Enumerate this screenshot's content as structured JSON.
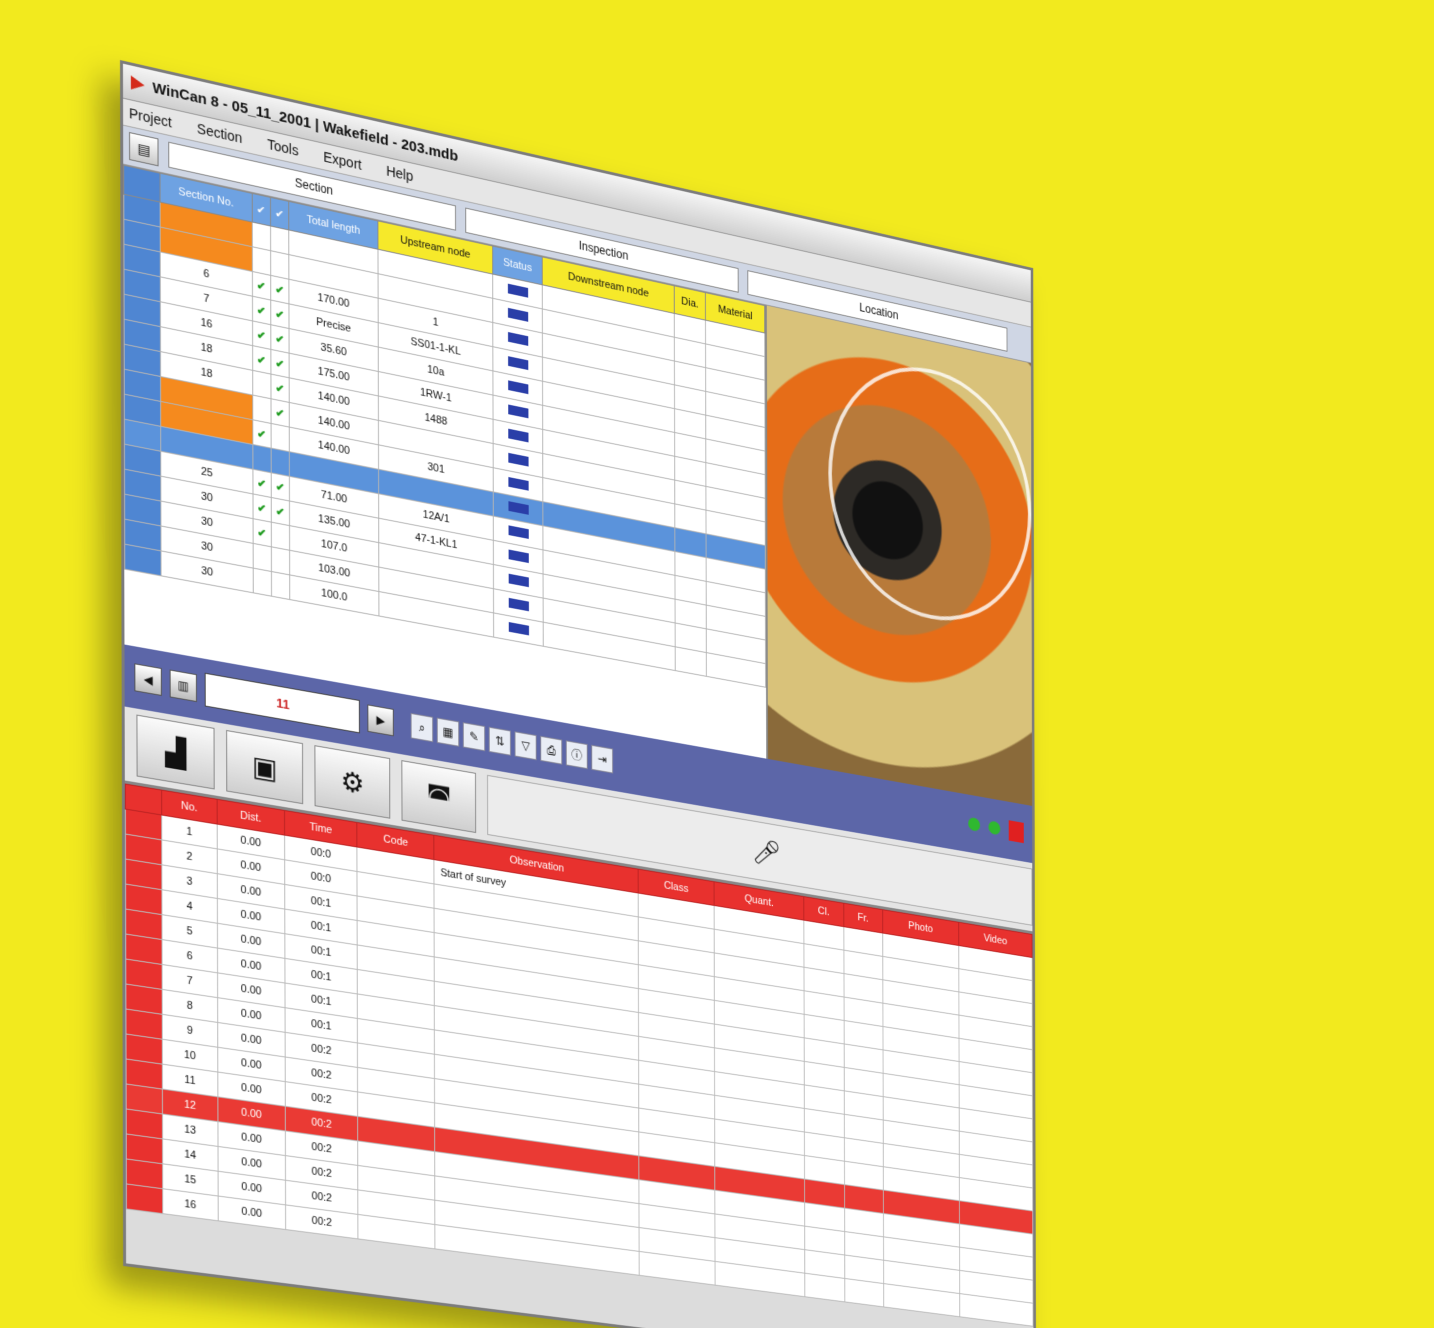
{
  "window": {
    "title": "WinCan 8 - 05_11_2001 | Wakefield - 203.mdb"
  },
  "menu": [
    "Project",
    "Section",
    "Tools",
    "Export",
    "Help"
  ],
  "toolstrip": {
    "field_1": "Section",
    "field_2": "Inspection",
    "field_3": "Location"
  },
  "sections_grid": {
    "headers": [
      "Section No.",
      "✔",
      "✔",
      "Total length",
      "Upstream node",
      "Status",
      "Downstream node",
      "Dia.",
      "Material"
    ],
    "rows": [
      {
        "id": "",
        "c1": "",
        "c2": "",
        "len": "",
        "up": "",
        "st": "",
        "down": "",
        "dia": "",
        "mat": "",
        "highlight": "orange"
      },
      {
        "id": "",
        "c1": "",
        "c2": "",
        "len": "",
        "up": "",
        "st": "",
        "down": "",
        "dia": "",
        "mat": "",
        "highlight": "orange"
      },
      {
        "id": "6",
        "c1": "✔",
        "c2": "✔",
        "len": "170.00",
        "up": "1",
        "st": "",
        "down": "",
        "dia": "",
        "mat": "",
        "highlight": ""
      },
      {
        "id": "7",
        "c1": "✔",
        "c2": "✔",
        "len": "Precise",
        "up": "SS01-1-KL",
        "st": "",
        "down": "",
        "dia": "",
        "mat": "",
        "highlight": ""
      },
      {
        "id": "16",
        "c1": "✔",
        "c2": "✔",
        "len": "35.60",
        "up": "10a",
        "st": "",
        "down": "",
        "dia": "",
        "mat": "",
        "highlight": ""
      },
      {
        "id": "18",
        "c1": "✔",
        "c2": "✔",
        "len": "175.00",
        "up": "1RW-1",
        "st": "",
        "down": "",
        "dia": "",
        "mat": "",
        "highlight": ""
      },
      {
        "id": "18",
        "c1": "",
        "c2": "✔",
        "len": "140.00",
        "up": "1488",
        "st": "",
        "down": "",
        "dia": "",
        "mat": "",
        "highlight": ""
      },
      {
        "id": "",
        "c1": "",
        "c2": "✔",
        "len": "140.00",
        "up": "",
        "st": "",
        "down": "",
        "dia": "",
        "mat": "",
        "highlight": "orange"
      },
      {
        "id": "",
        "c1": "✔",
        "c2": "",
        "len": "140.00",
        "up": "301",
        "st": "",
        "down": "",
        "dia": "",
        "mat": "",
        "highlight": "orange"
      },
      {
        "id": "",
        "c1": "",
        "c2": "",
        "len": "",
        "up": "",
        "st": "",
        "down": "",
        "dia": "",
        "mat": "",
        "highlight": "selected"
      },
      {
        "id": "25",
        "c1": "✔",
        "c2": "✔",
        "len": "71.00",
        "up": "12A/1",
        "st": "",
        "down": "",
        "dia": "",
        "mat": "",
        "highlight": ""
      },
      {
        "id": "30",
        "c1": "✔",
        "c2": "✔",
        "len": "135.00",
        "up": "47-1-KL1",
        "st": "",
        "down": "",
        "dia": "",
        "mat": "",
        "highlight": ""
      },
      {
        "id": "30",
        "c1": "✔",
        "c2": "",
        "len": "107.0",
        "up": "",
        "st": "",
        "down": "",
        "dia": "",
        "mat": "",
        "highlight": ""
      },
      {
        "id": "30",
        "c1": "",
        "c2": "",
        "len": "103.00",
        "up": "",
        "st": "",
        "down": "",
        "dia": "",
        "mat": "",
        "highlight": ""
      },
      {
        "id": "30",
        "c1": "",
        "c2": "",
        "len": "100.0",
        "up": "",
        "st": "",
        "down": "",
        "dia": "",
        "mat": "",
        "highlight": ""
      }
    ]
  },
  "navbar": {
    "counter": "11"
  },
  "observations_grid": {
    "headers": [
      "No.",
      "Dist.",
      "Time",
      "Code",
      "Observation",
      "Class",
      "Quant.",
      "Cl.",
      "Fr.",
      "Photo",
      "Video"
    ],
    "rows": [
      {
        "no": "1",
        "dist": "0.00",
        "time": "00:0",
        "desc": "Start of survey",
        "red": false
      },
      {
        "no": "2",
        "dist": "0.00",
        "time": "00:0",
        "desc": "",
        "red": false
      },
      {
        "no": "3",
        "dist": "0.00",
        "time": "00:1",
        "desc": "",
        "red": false
      },
      {
        "no": "4",
        "dist": "0.00",
        "time": "00:1",
        "desc": "",
        "red": false
      },
      {
        "no": "5",
        "dist": "0.00",
        "time": "00:1",
        "desc": "",
        "red": false
      },
      {
        "no": "6",
        "dist": "0.00",
        "time": "00:1",
        "desc": "",
        "red": false
      },
      {
        "no": "7",
        "dist": "0.00",
        "time": "00:1",
        "desc": "",
        "red": false
      },
      {
        "no": "8",
        "dist": "0.00",
        "time": "00:1",
        "desc": "",
        "red": false
      },
      {
        "no": "9",
        "dist": "0.00",
        "time": "00:2",
        "desc": "",
        "red": false
      },
      {
        "no": "10",
        "dist": "0.00",
        "time": "00:2",
        "desc": "",
        "red": false
      },
      {
        "no": "11",
        "dist": "0.00",
        "time": "00:2",
        "desc": "",
        "red": false
      },
      {
        "no": "12",
        "dist": "0.00",
        "time": "00:2",
        "desc": "",
        "red": true
      },
      {
        "no": "13",
        "dist": "0.00",
        "time": "00:2",
        "desc": "",
        "red": false
      },
      {
        "no": "14",
        "dist": "0.00",
        "time": "00:2",
        "desc": "",
        "red": false
      },
      {
        "no": "15",
        "dist": "0.00",
        "time": "00:2",
        "desc": "",
        "red": false
      },
      {
        "no": "16",
        "dist": "0.00",
        "time": "00:2",
        "desc": "",
        "red": false
      }
    ]
  },
  "colors": {
    "background": "#f2ea1e",
    "row_header_blue": "#4f86d2",
    "orange": "#f58a1e",
    "red": "#e8312e"
  }
}
